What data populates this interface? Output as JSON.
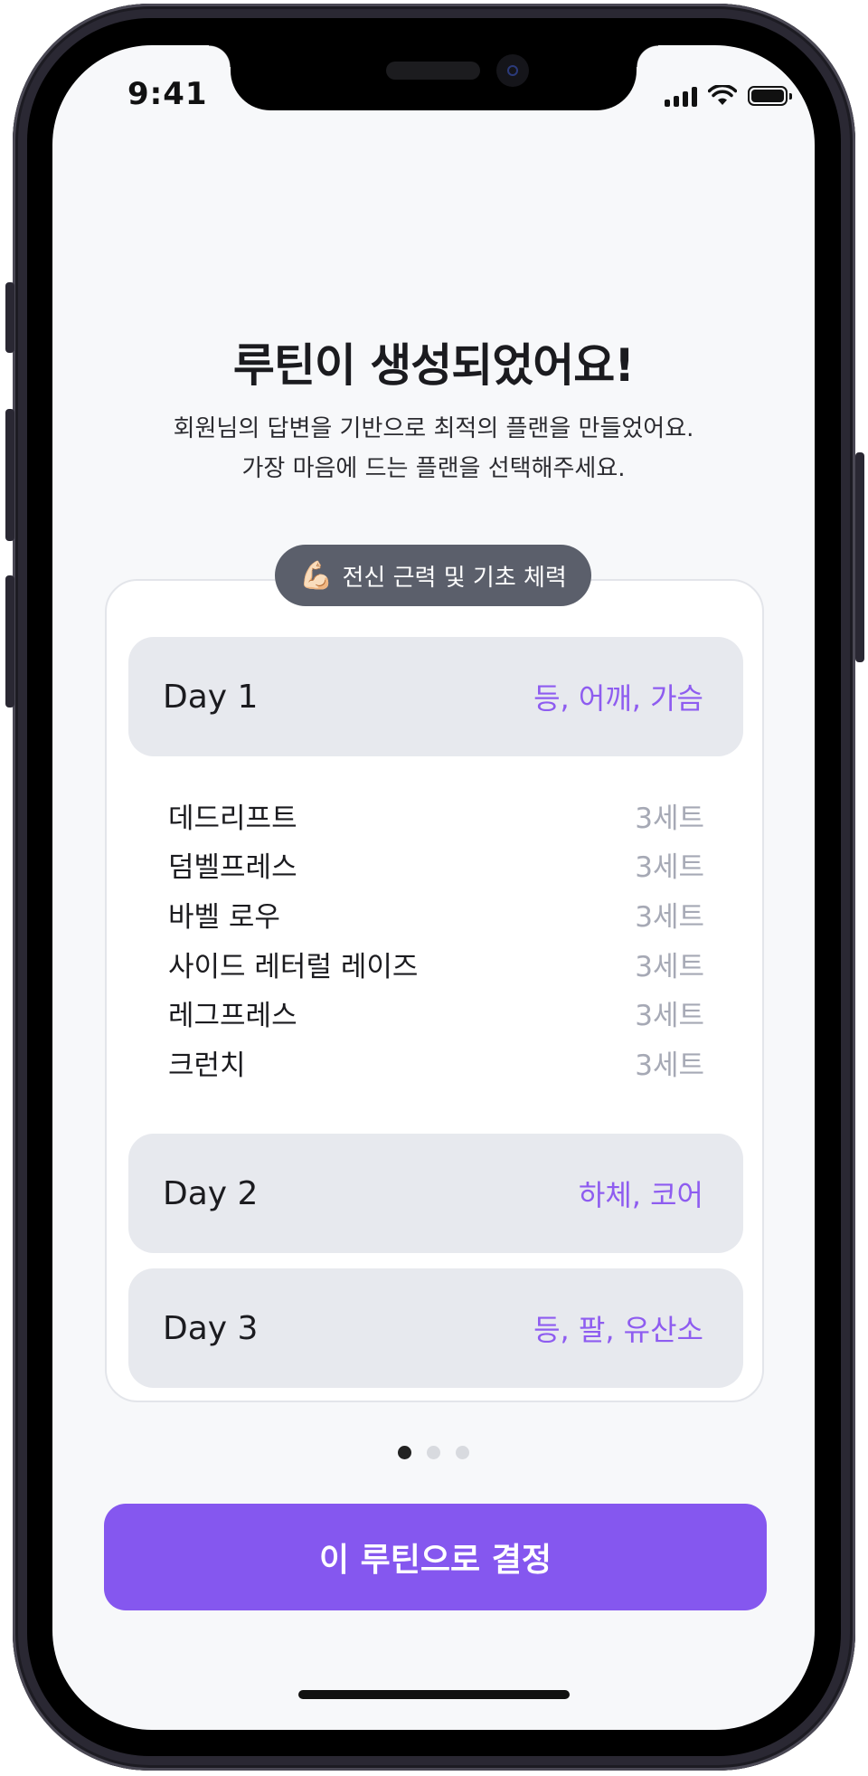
{
  "status_bar": {
    "time": "9:41"
  },
  "header": {
    "title": "루틴이 생성되었어요!",
    "subtitle_line1": "회원님의 답변을 기반으로 최적의 플랜을 만들었어요.",
    "subtitle_line2": "가장 마음에 드는 플랜을 선택해주세요."
  },
  "plan": {
    "goal_icon": "💪🏻",
    "goal_label": "전신 근력 및 기초 체력",
    "days": [
      {
        "label": "Day 1",
        "parts": "등, 어깨, 가슴"
      },
      {
        "label": "Day 2",
        "parts": "하체, 코어"
      },
      {
        "label": "Day 3",
        "parts": "등, 팔, 유산소"
      }
    ],
    "exercises": [
      {
        "name": "데드리프트",
        "sets": "3세트"
      },
      {
        "name": "덤벨프레스",
        "sets": "3세트"
      },
      {
        "name": "바벨 로우",
        "sets": "3세트"
      },
      {
        "name": "사이드 레터럴 레이즈",
        "sets": "3세트"
      },
      {
        "name": "레그프레스",
        "sets": "3세트"
      },
      {
        "name": "크런치",
        "sets": "3세트"
      }
    ]
  },
  "pagination": {
    "total": 3,
    "active": 1
  },
  "cta": {
    "label": "이 루틴으로 결정"
  },
  "colors": {
    "accent": "#8557ef",
    "accent_text": "#8e5cf0",
    "badge_bg": "#5b5f6b",
    "day_bg": "#e7e9ee"
  }
}
